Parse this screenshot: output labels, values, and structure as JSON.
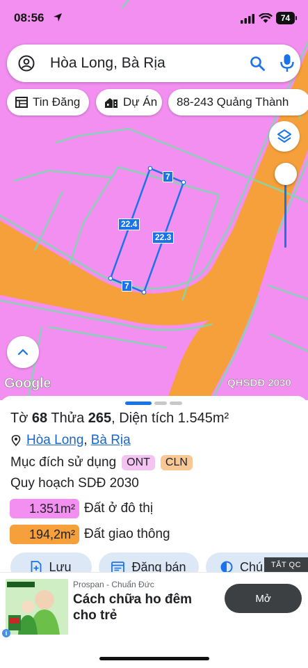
{
  "status_bar": {
    "time": "08:56",
    "battery": "74"
  },
  "search": {
    "query": "Hòa Long, Bà Rịa"
  },
  "chips": [
    {
      "label": "Tin Đăng",
      "icon": "listing-icon"
    },
    {
      "label": "Dự Án",
      "icon": "building-icon"
    },
    {
      "label": "88-243 Quảng Thành",
      "icon": ""
    }
  ],
  "map": {
    "google_label": "Google",
    "layer_label": "QHSDĐ 2030",
    "parcel_labels": {
      "top": "7",
      "bottom": "7",
      "left": "22.4",
      "right": "22.3"
    },
    "colors": {
      "residential": "#f28ff0",
      "road": "#f6a03b",
      "plot_outline": "#1a73e8"
    }
  },
  "sheet": {
    "title_prefix": "Tờ",
    "sheet_no": "68",
    "plot_prefix": "Thửa",
    "plot_no": "265",
    "area_prefix": ", Diện tích",
    "area": "1.545m²",
    "commune": "Hòa Long",
    "city": "Bà Rịa",
    "purpose_label": "Mục đích sử dụng",
    "purpose_tags": [
      "ONT",
      "CLN"
    ],
    "plan_label": "Quy hoạch SDĐ 2030",
    "zones": [
      {
        "area": "1.351m²",
        "label": "Đất ở đô thị",
        "color": "#f28ff0"
      },
      {
        "area": "194,2m²",
        "label": "Đất giao thông",
        "color": "#f6a03b"
      }
    ],
    "actions": {
      "save": "Lưu",
      "post": "Đăng bán",
      "legend": "Chú thích"
    },
    "ad_off": "TẮT QC"
  },
  "ad": {
    "brand": "Prospan - Chuẩn Đức",
    "headline": "Cách chữa ho đêm cho trẻ",
    "cta": "Mở"
  }
}
